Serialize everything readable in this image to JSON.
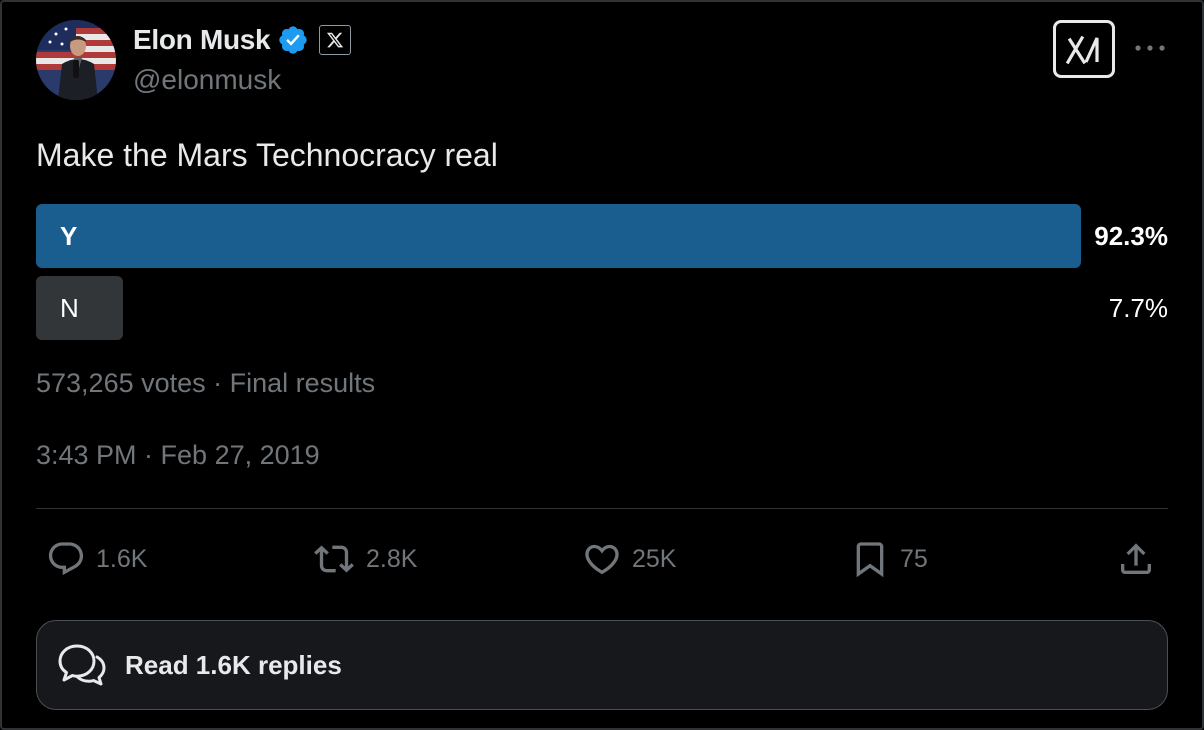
{
  "author": {
    "name": "Elon Musk",
    "handle": "@elonmusk",
    "verified_color": "#1d9bf0",
    "avatar_icon": "avatar-photo"
  },
  "tweet": {
    "text": "Make the Mars Technocracy real",
    "timestamp": "3:43 PM · Feb 27, 2019"
  },
  "poll": {
    "options": [
      {
        "label": "Y",
        "percent_text": "92.3%",
        "percent": 92.3,
        "winner": true,
        "color": "#1a5d8f"
      },
      {
        "label": "N",
        "percent_text": "7.7%",
        "percent": 7.7,
        "winner": false,
        "color": "#333639"
      }
    ],
    "summary": "573,265 votes · Final results"
  },
  "actions": {
    "replies": "1.6K",
    "reposts": "2.8K",
    "likes": "25K",
    "bookmarks": "75"
  },
  "read_replies": "Read 1.6K replies",
  "icons": [
    "verified-badge-icon",
    "x-logo-icon",
    "grok-icon",
    "more-icon",
    "reply-icon",
    "repost-icon",
    "like-icon",
    "bookmark-icon",
    "share-icon",
    "read-replies-icon"
  ]
}
